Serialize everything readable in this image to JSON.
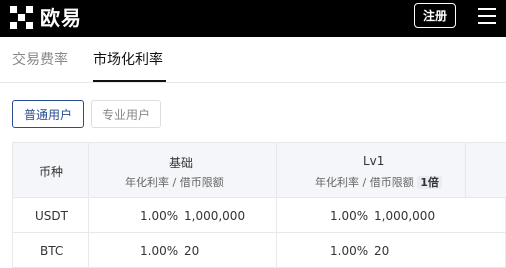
{
  "header": {
    "brand": "欧易",
    "register_label": "注册"
  },
  "tabs": [
    {
      "label": "交易费率",
      "active": false
    },
    {
      "label": "市场化利率",
      "active": true
    }
  ],
  "user_types": [
    {
      "label": "普通用户",
      "active": true
    },
    {
      "label": "专业用户",
      "active": false
    }
  ],
  "table": {
    "col_coin": "币种",
    "groups": [
      {
        "title": "基础",
        "sub_rate": "年化利率",
        "sep": "/",
        "sub_limit": "借币限额",
        "badge": ""
      },
      {
        "title": "Lv1",
        "sub_rate": "年化利率",
        "sep": "/",
        "sub_limit": "借币限额",
        "badge": "1倍"
      }
    ],
    "rows": [
      {
        "coin": "USDT",
        "base_rate": "1.00%",
        "base_limit": "1,000,000",
        "lv1_rate": "1.00%",
        "lv1_limit": "1,000,000"
      },
      {
        "coin": "BTC",
        "base_rate": "1.00%",
        "base_limit": "20",
        "lv1_rate": "1.00%",
        "lv1_limit": "20"
      }
    ]
  }
}
